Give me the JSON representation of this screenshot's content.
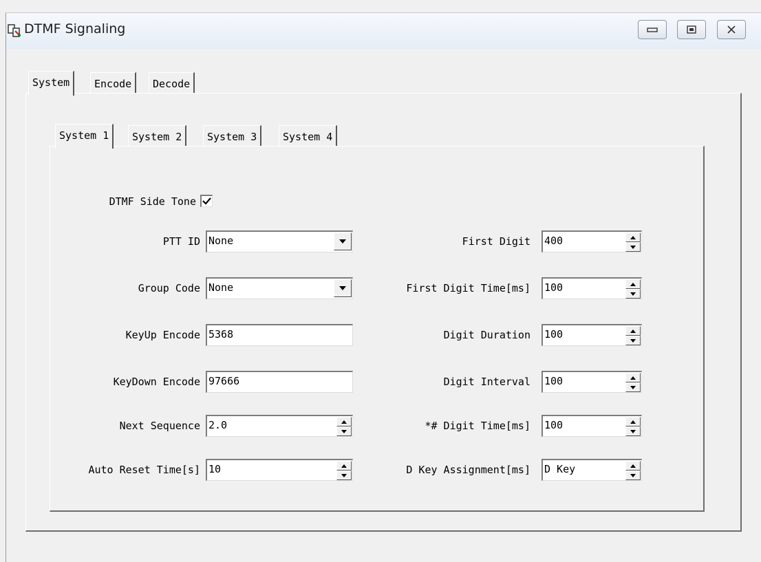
{
  "window": {
    "title": "DTMF Signaling"
  },
  "outer_tabs": [
    "System",
    "Encode",
    "Decode"
  ],
  "inner_tabs": [
    "System 1",
    "System 2",
    "System 3",
    "System 4"
  ],
  "side_tone": {
    "label": "DTMF Side Tone",
    "checked": true
  },
  "left": {
    "ptt_id": {
      "label": "PTT ID",
      "value": "None"
    },
    "group_code": {
      "label": "Group Code",
      "value": "None"
    },
    "keyup_encode": {
      "label": "KeyUp Encode",
      "value": "5368"
    },
    "keydown_encode": {
      "label": "KeyDown Encode",
      "value": "97666"
    },
    "next_sequence": {
      "label": "Next Sequence",
      "value": "2.0"
    },
    "auto_reset_time": {
      "label": "Auto Reset Time[s]",
      "value": "10"
    }
  },
  "right": {
    "first_digit": {
      "label": "First Digit",
      "value": "400"
    },
    "first_digit_time": {
      "label": "First Digit Time[ms]",
      "value": "100"
    },
    "digit_duration": {
      "label": "Digit Duration",
      "value": "100"
    },
    "digit_interval": {
      "label": "Digit Interval",
      "value": "100"
    },
    "star_hash_digit_time": {
      "label": "*# Digit Time[ms]",
      "value": "100"
    },
    "d_key_assignment": {
      "label": "D Key Assignment[ms]",
      "value": "D Key"
    }
  },
  "icons": {
    "app": "dtmf-app-icon",
    "minimize": "minimize-icon",
    "maximize": "maximize-icon",
    "close": "close-icon",
    "dropdown": "chevron-down-icon",
    "spin_up": "spin-up-icon",
    "spin_down": "spin-down-icon",
    "check": "checkmark-icon"
  },
  "colors": {
    "titlebar": "#e6edf6",
    "window_bg": "#f0f0f0",
    "field_bg": "#ffffff"
  }
}
